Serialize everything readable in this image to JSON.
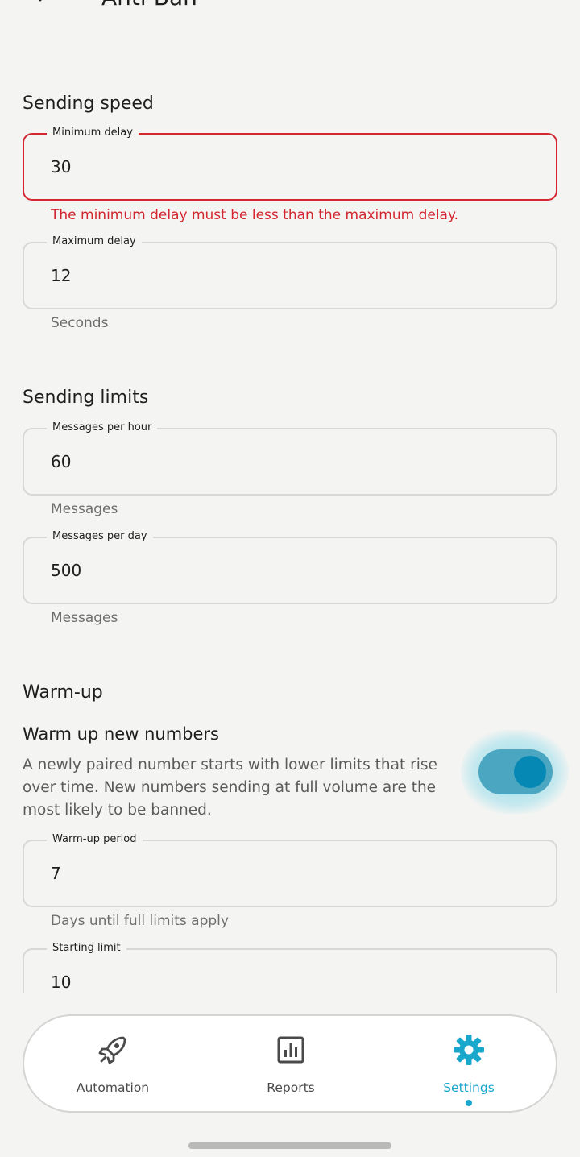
{
  "header": {
    "title": "Anti-Ban"
  },
  "sections": {
    "speed": {
      "title": "Sending speed",
      "min_label": "Minimum delay",
      "min_value": "30",
      "min_error": "The minimum delay must be less than the maximum delay.",
      "max_label": "Maximum delay",
      "max_value": "12",
      "max_helper": "Seconds"
    },
    "limits": {
      "title": "Sending limits",
      "hour_label": "Messages per hour",
      "hour_value": "60",
      "hour_helper": "Messages",
      "day_label": "Messages per day",
      "day_value": "500",
      "day_helper": "Messages"
    },
    "warmup": {
      "title": "Warm-up",
      "toggle_title": "Warm up new numbers",
      "toggle_desc": "A newly paired number starts with lower limits that rise over time. New numbers sending at full volume are the most likely to be banned.",
      "toggle_on": true,
      "period_label": "Warm-up period",
      "period_value": "7",
      "period_helper": "Days until full limits apply",
      "start_label": "Starting limit",
      "start_value": "10"
    }
  },
  "nav": {
    "items": [
      {
        "label": "Automation",
        "icon": "rocket-icon"
      },
      {
        "label": "Reports",
        "icon": "bar-chart-icon"
      },
      {
        "label": "Settings",
        "icon": "gear-icon",
        "active": true
      }
    ]
  },
  "colors": {
    "accent": "#1aa7cc",
    "error": "#d3262e",
    "switch_track": "#4aa6c1",
    "switch_knob": "#0588b4",
    "background": "#f4f4f2"
  }
}
